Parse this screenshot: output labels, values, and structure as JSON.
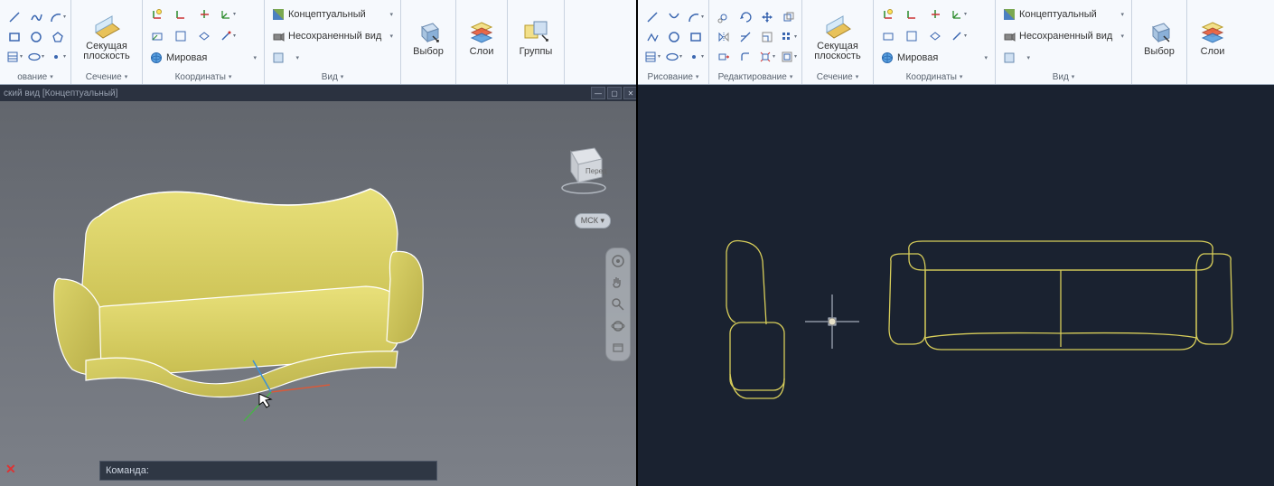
{
  "left": {
    "ribbon": {
      "panels": {
        "p0": {
          "title": "ование"
        },
        "section": {
          "big_label": "Секущая\nплоскость",
          "title": "Сечение"
        },
        "coords": {
          "row_world": "Мировая",
          "title": "Координаты"
        },
        "view": {
          "row_visual": "Концептуальный",
          "row_unsaved": "Несохраненный вид",
          "title": "Вид"
        },
        "select": {
          "big_label": "Выбор"
        },
        "layers": {
          "big_label": "Слои"
        },
        "groups": {
          "big_label": "Группы"
        }
      }
    },
    "viewport": {
      "titlebar_text": "ский вид [Концептуальный]",
      "cube_face": "Перед",
      "ucs_badge": "МСК",
      "command_prompt": "Команда:"
    }
  },
  "right": {
    "ribbon": {
      "panels": {
        "draw": {
          "title": "Рисование"
        },
        "edit": {
          "title": "Редактирование"
        },
        "section": {
          "big_label": "Секущая\nплоскость",
          "title": "Сечение"
        },
        "coords": {
          "row_world": "Мировая",
          "title": "Координаты"
        },
        "view": {
          "row_visual": "Концептуальный",
          "row_unsaved": "Несохраненный вид",
          "title": "Вид"
        },
        "select": {
          "big_label": "Выбор"
        },
        "layers": {
          "big_label": "Слои"
        }
      }
    }
  }
}
